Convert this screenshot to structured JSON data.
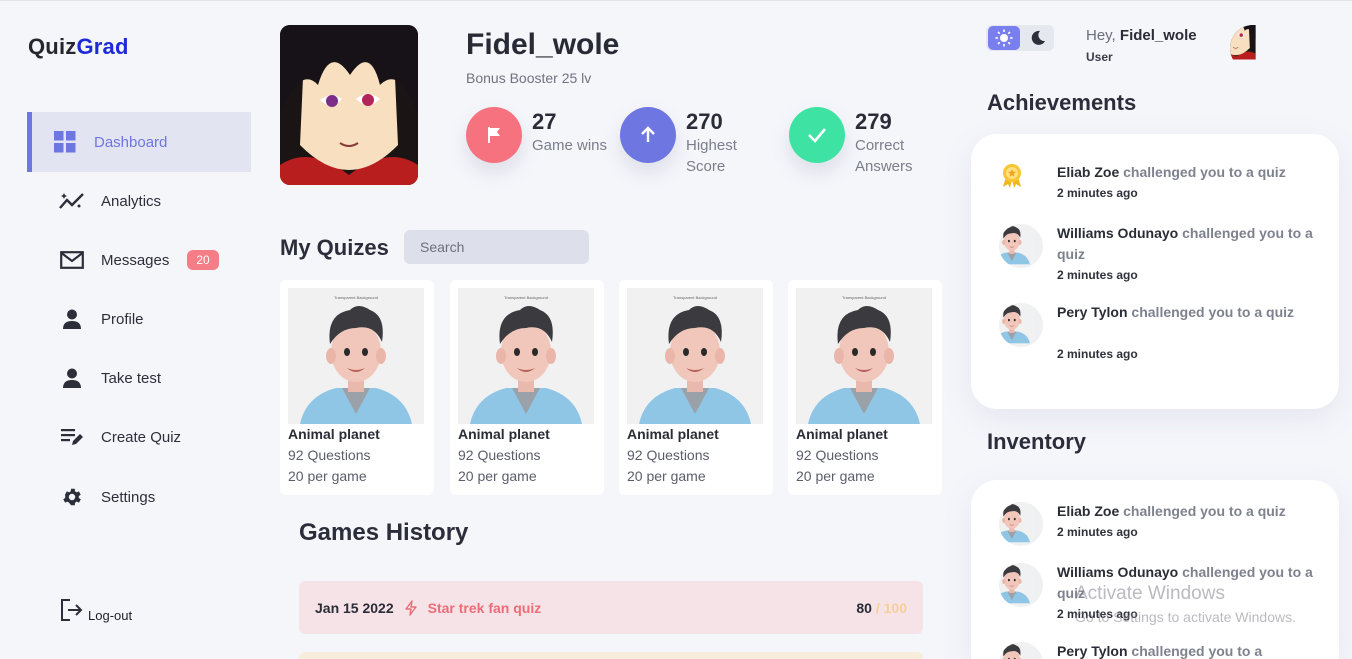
{
  "logo": {
    "part1": "Quiz",
    "part2": "Grad"
  },
  "sidebar": {
    "items": [
      {
        "label": "Dashboard",
        "icon": "grid-icon"
      },
      {
        "label": "Analytics",
        "icon": "analytics-icon"
      },
      {
        "label": "Messages",
        "icon": "mail-icon",
        "badge": "20"
      },
      {
        "label": "Profile",
        "icon": "person-icon"
      },
      {
        "label": "Take test",
        "icon": "person-icon"
      },
      {
        "label": "Create Quiz",
        "icon": "edit-list-icon"
      },
      {
        "label": "Settings",
        "icon": "gear-icon"
      }
    ],
    "logout": "Log-out"
  },
  "profile": {
    "name": "Fidel_wole",
    "subtitle": "Bonus Booster 25 lv",
    "stats": [
      {
        "value": "27",
        "label": "Game wins",
        "icon": "flag-icon",
        "color": "#f6727e"
      },
      {
        "value": "270",
        "label": "Highest Score",
        "icon": "arrow-up-icon",
        "color": "#6e76e2"
      },
      {
        "value": "279",
        "label": "Correct Answers",
        "icon": "check-icon",
        "color": "#3ee3a4"
      }
    ]
  },
  "quizzes": {
    "title": "My Quizes",
    "search_placeholder": "Search",
    "image_caption": "Transparent Background",
    "items": [
      {
        "title": "Animal planet",
        "questions": "92 Questions",
        "per_game": "20 per game"
      },
      {
        "title": "Animal planet",
        "questions": "92 Questions",
        "per_game": "20 per game"
      },
      {
        "title": "Animal planet",
        "questions": "92 Questions",
        "per_game": "20 per game"
      },
      {
        "title": "Animal planet",
        "questions": "92 Questions",
        "per_game": "20 per game"
      }
    ]
  },
  "history": {
    "title": "Games History",
    "rows": [
      {
        "date": "Jan 15 2022",
        "name": "Star trek fan quiz",
        "score": "80",
        "total": " / 100"
      }
    ]
  },
  "header": {
    "greeting": "Hey, ",
    "username": "Fidel_wole",
    "role": "User"
  },
  "achievements": {
    "title": "Achievements",
    "items": [
      {
        "name": "Eliab Zoe",
        "text": " challenged you to a quiz",
        "time": "2 minutes ago",
        "icon": "award-icon"
      },
      {
        "name": "Williams Odunayo",
        "text": " challenged you to a quiz",
        "time": "2 minutes ago"
      },
      {
        "name": "Pery Tylon",
        "text": " challenged you to a quiz",
        "time": "2 minutes ago"
      }
    ]
  },
  "inventory": {
    "title": "Inventory",
    "items": [
      {
        "name": "Eliab Zoe",
        "text": " challenged you to a quiz",
        "time": "2 minutes ago"
      },
      {
        "name": "Williams Odunayo",
        "text": " challenged you to a quiz",
        "time": "2 minutes ago"
      },
      {
        "name": "Pery Tylon",
        "text": " challenged you to a",
        "time": ""
      }
    ]
  },
  "watermark": {
    "line1": "Activate Windows",
    "line2": "Go to Settings to activate Windows."
  }
}
